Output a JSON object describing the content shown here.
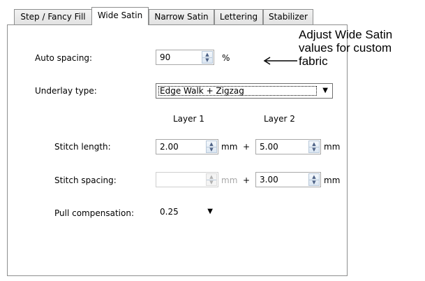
{
  "tabs": [
    {
      "label": "Step / Fancy Fill"
    },
    {
      "label": "Wide Satin"
    },
    {
      "label": "Narrow Satin"
    },
    {
      "label": "Lettering"
    },
    {
      "label": "Stabilizer"
    }
  ],
  "auto_spacing": {
    "label": "Auto spacing:",
    "value": "90",
    "unit": "%"
  },
  "underlay": {
    "label": "Underlay type:",
    "value": "Edge Walk + Zigzag"
  },
  "layers": {
    "layer1": "Layer 1",
    "layer2": "Layer 2"
  },
  "stitch_length": {
    "label": "Stitch length:",
    "layer1_value": "2.00",
    "layer1_unit": "mm",
    "plus": "+",
    "layer2_value": "5.00",
    "layer2_unit": "mm"
  },
  "stitch_spacing": {
    "label": "Stitch spacing:",
    "layer1_value": "",
    "layer1_unit": "mm",
    "plus": "+",
    "layer2_value": "3.00",
    "layer2_unit": "mm"
  },
  "pull_compensation": {
    "label": "Pull compensation:",
    "value": "0.25"
  },
  "annotation": {
    "line1": "Adjust Wide Satin",
    "line2": "values for custom",
    "line3": "fabric"
  },
  "icons": {
    "spin": "spin-arrows-icon",
    "dropdown": "chevron-down-icon",
    "callout": "arrow-left-icon"
  }
}
